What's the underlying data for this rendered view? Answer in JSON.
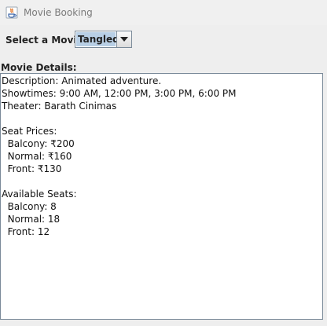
{
  "window": {
    "title": "Movie Booking"
  },
  "icons": {
    "app_icon": "java-icon",
    "dropdown_icon": "chevron-down-icon"
  },
  "colors": {
    "selection_highlight": "#b8cfe5",
    "border": "#7a8a99",
    "background": "#eeeeee"
  },
  "movie_select": {
    "label": "Select a Movie:",
    "selected_value": "Tangled"
  },
  "details": {
    "label": "Movie Details:",
    "lines": [
      "Description: Animated adventure.",
      "Showtimes: 9:00 AM, 12:00 PM, 3:00 PM, 6:00 PM",
      "Theater: Barath Cinimas",
      "",
      "Seat Prices:",
      "  Balcony: ₹200",
      "  Normal: ₹160",
      "  Front: ₹130",
      "",
      "Available Seats:",
      "  Balcony: 8",
      "  Normal: 18",
      "  Front: 12"
    ]
  }
}
